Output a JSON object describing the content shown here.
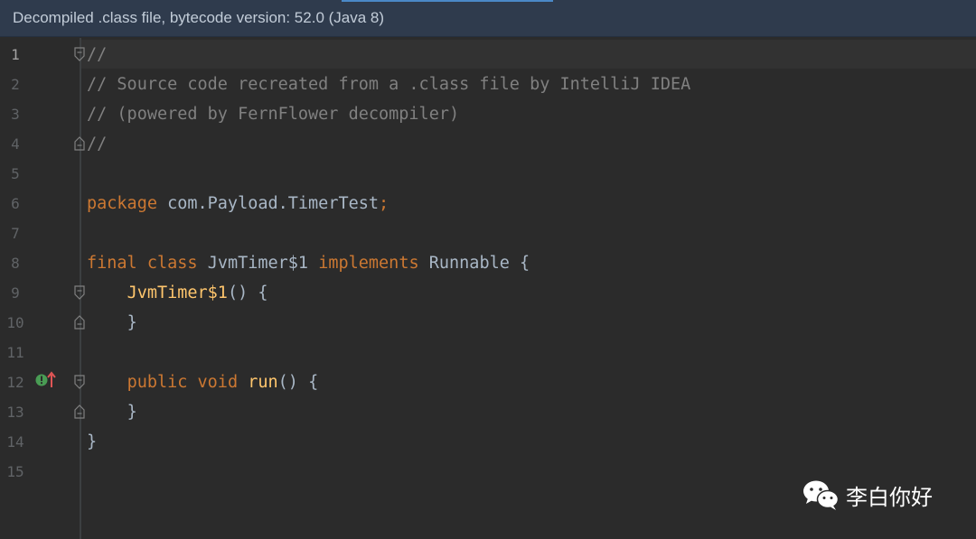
{
  "banner": {
    "text": "Decompiled .class file, bytecode version: 52.0 (Java 8)"
  },
  "editor": {
    "line_numbers": [
      "1",
      "2",
      "3",
      "4",
      "5",
      "6",
      "7",
      "8",
      "9",
      "10",
      "11",
      "12",
      "13",
      "14",
      "15"
    ],
    "lines": {
      "l1": "//",
      "l2": "// Source code recreated from a .class file by IntelliJ IDEA",
      "l3": "// (powered by FernFlower decompiler)",
      "l4": "//",
      "l6_kw": "package",
      "l6_rest": " com.Payload.TimerTest",
      "l6_semi": ";",
      "l8_kw1": "final",
      "l8_kw2": "class",
      "l8_name": "JvmTimer$1",
      "l8_kw3": "implements",
      "l8_rest": "Runnable {",
      "l9_fn": "JvmTimer$1",
      "l9_rest": "() {",
      "l10": "}",
      "l12_kw1": "public",
      "l12_kw2": "void",
      "l12_fn": "run",
      "l12_rest": "() {",
      "l13": "}",
      "l14": "}"
    },
    "override_marker": "implements-method-icon"
  },
  "watermark": {
    "text": "李白你好",
    "icon": "wechat-icon"
  }
}
